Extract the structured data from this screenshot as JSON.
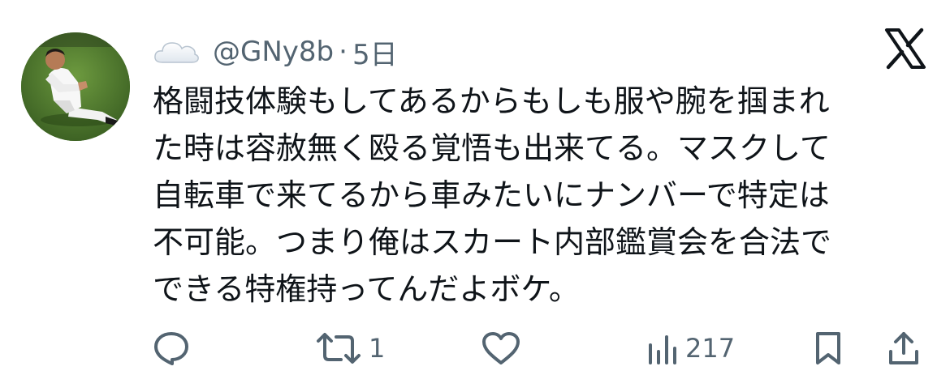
{
  "author": {
    "handle": "@GNy8b",
    "separator": "·",
    "time": "5日"
  },
  "icons": {
    "avatar": "profile-photo",
    "cloud": "cloud-icon",
    "x_logo": "x-logo-icon",
    "reply": "comment-bubble-icon",
    "retweet": "retweet-icon",
    "like": "heart-icon",
    "views": "bar-chart-icon",
    "bookmark": "bookmark-icon",
    "share": "share-upload-icon"
  },
  "tweet": {
    "lines": [
      "格闘技体験もしてあるからもしも服や腕を掴まれ",
      "た時は容赦無く殴る覚悟も出来てる。マスクして",
      "自転車で来てるから車みたいにナンバーで特定は",
      "不可能。つまり俺はスカート内部鑑賞会を合法で",
      "できる特権持ってんだよボケ。"
    ]
  },
  "metrics": {
    "retweets": "1",
    "views": "217"
  },
  "colors": {
    "text": "#0f1419",
    "muted": "#536471",
    "background": "#ffffff"
  }
}
